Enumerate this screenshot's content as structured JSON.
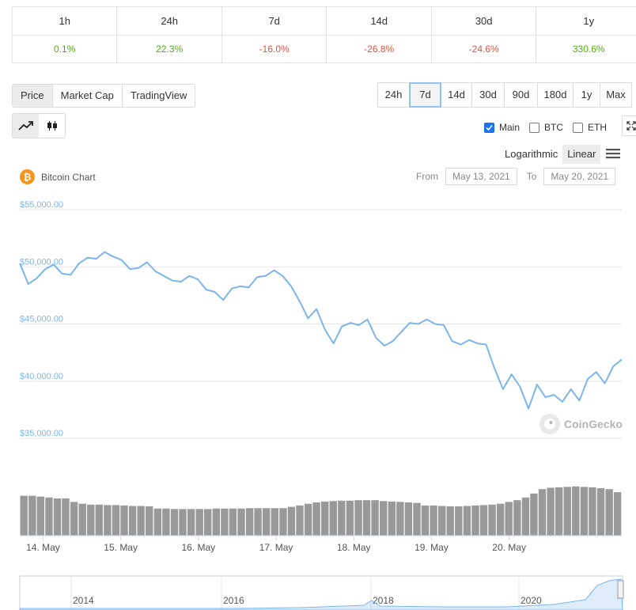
{
  "changes": {
    "headers": [
      "1h",
      "24h",
      "7d",
      "14d",
      "30d",
      "1y"
    ],
    "values": [
      "0.1%",
      "22.3%",
      "-16.0%",
      "-26.8%",
      "-24.6%",
      "330.6%"
    ]
  },
  "metric_tabs": [
    "Price",
    "Market Cap",
    "TradingView"
  ],
  "range_tabs": [
    "24h",
    "7d",
    "14d",
    "30d",
    "90d",
    "180d",
    "1y",
    "Max"
  ],
  "compare": {
    "main": "Main",
    "btc": "BTC",
    "eth": "ETH"
  },
  "scale": {
    "log": "Logarithmic",
    "linear": "Linear"
  },
  "chart_header": {
    "title": "Bitcoin Chart",
    "from_label": "From",
    "from_date": "May 13, 2021",
    "to_label": "To",
    "to_date": "May 20, 2021"
  },
  "watermark": "CoinGecko",
  "colors": {
    "line": "#7cb5ec",
    "volume": "#999999",
    "positive": "#4eaf0a",
    "negative": "#e15241",
    "btc": "#f7931a"
  },
  "chart_data": {
    "type": "line",
    "title": "Bitcoin Chart",
    "ylim": [
      35000,
      55000
    ],
    "yticks": [
      35000,
      40000,
      45000,
      50000,
      55000
    ],
    "ytick_labels": [
      "$35,000.00",
      "$40,000.00",
      "$45,000.00",
      "$50,000.00",
      "$55,000.00"
    ],
    "xticks": [
      1,
      2,
      3,
      4,
      5,
      6,
      7
    ],
    "xtick_labels": [
      "14. May",
      "15. May",
      "16. May",
      "17. May",
      "18. May",
      "19. May",
      "20. May"
    ],
    "grid": true,
    "x": [
      0.0,
      0.125,
      0.25,
      0.375,
      0.5,
      0.625,
      0.75,
      0.875,
      1.0,
      1.125,
      1.25,
      1.375,
      1.5,
      1.625,
      1.75,
      1.875,
      2.0,
      2.125,
      2.25,
      2.375,
      2.5,
      2.625,
      2.75,
      2.875,
      3.0,
      3.125,
      3.25,
      3.375,
      3.5,
      3.625,
      3.75,
      3.875,
      4.0,
      4.125,
      4.25,
      4.375,
      4.5,
      4.625,
      4.75,
      4.875,
      5.0,
      5.125,
      5.25,
      5.375,
      5.5,
      5.625,
      5.75,
      5.875,
      6.0,
      6.125,
      6.25,
      6.375,
      6.5,
      6.625,
      6.75,
      6.875,
      7.0,
      7.125,
      7.25,
      7.375,
      7.5,
      7.625,
      7.75
    ],
    "price": [
      50300,
      48500,
      49000,
      49800,
      50200,
      49400,
      49300,
      50300,
      50800,
      50700,
      51300,
      50900,
      50600,
      49800,
      49900,
      50400,
      49600,
      49200,
      48800,
      48700,
      49200,
      48900,
      48000,
      47800,
      47100,
      48100,
      48300,
      48200,
      49100,
      49200,
      49700,
      49200,
      48300,
      47000,
      45500,
      46300,
      44500,
      43300,
      44800,
      45100,
      44900,
      45400,
      43800,
      43100,
      43500,
      44300,
      45100,
      45000,
      45400,
      45000,
      44900,
      43500,
      43200,
      43600,
      43300,
      43200,
      41100,
      39300,
      40600,
      39500,
      37600,
      39700,
      38600,
      38800,
      38200,
      39300,
      38300,
      40200,
      40800,
      39800,
      41300,
      41900
    ],
    "volume": [
      0.9,
      0.9,
      0.88,
      0.86,
      0.84,
      0.84,
      0.76,
      0.72,
      0.7,
      0.7,
      0.69,
      0.69,
      0.68,
      0.67,
      0.67,
      0.66,
      0.61,
      0.61,
      0.6,
      0.6,
      0.6,
      0.6,
      0.6,
      0.61,
      0.61,
      0.61,
      0.61,
      0.62,
      0.62,
      0.62,
      0.62,
      0.62,
      0.65,
      0.68,
      0.72,
      0.75,
      0.77,
      0.78,
      0.79,
      0.79,
      0.8,
      0.8,
      0.8,
      0.78,
      0.77,
      0.76,
      0.75,
      0.74,
      0.68,
      0.68,
      0.67,
      0.66,
      0.66,
      0.67,
      0.68,
      0.69,
      0.7,
      0.72,
      0.76,
      0.8,
      0.86,
      0.95,
      1.05,
      1.08,
      1.09,
      1.1,
      1.11,
      1.1,
      1.09,
      1.07,
      1.05,
      0.98
    ]
  },
  "navigator": {
    "labels": [
      "2014",
      "2016",
      "2018",
      "2020"
    ]
  }
}
